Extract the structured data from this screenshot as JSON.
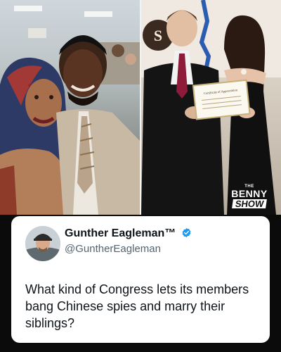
{
  "photos": {
    "left": {
      "icon": "photo-couple-selfie"
    },
    "right": {
      "icon": "photo-award-ceremony",
      "sign_letters": "S",
      "certificate_text": "Certificate of Appreciation"
    }
  },
  "logo": {
    "top": "THE",
    "mid": "BENNY",
    "bottom": "SHOW"
  },
  "tweet": {
    "display_name": "Gunther Eagleman™",
    "handle": "@GuntherEagleman",
    "verified_icon": "verified-badge-icon",
    "verified_color": "#1d9bf0",
    "text": "What kind of Congress lets its members bang Chinese spies and marry their siblings?"
  }
}
